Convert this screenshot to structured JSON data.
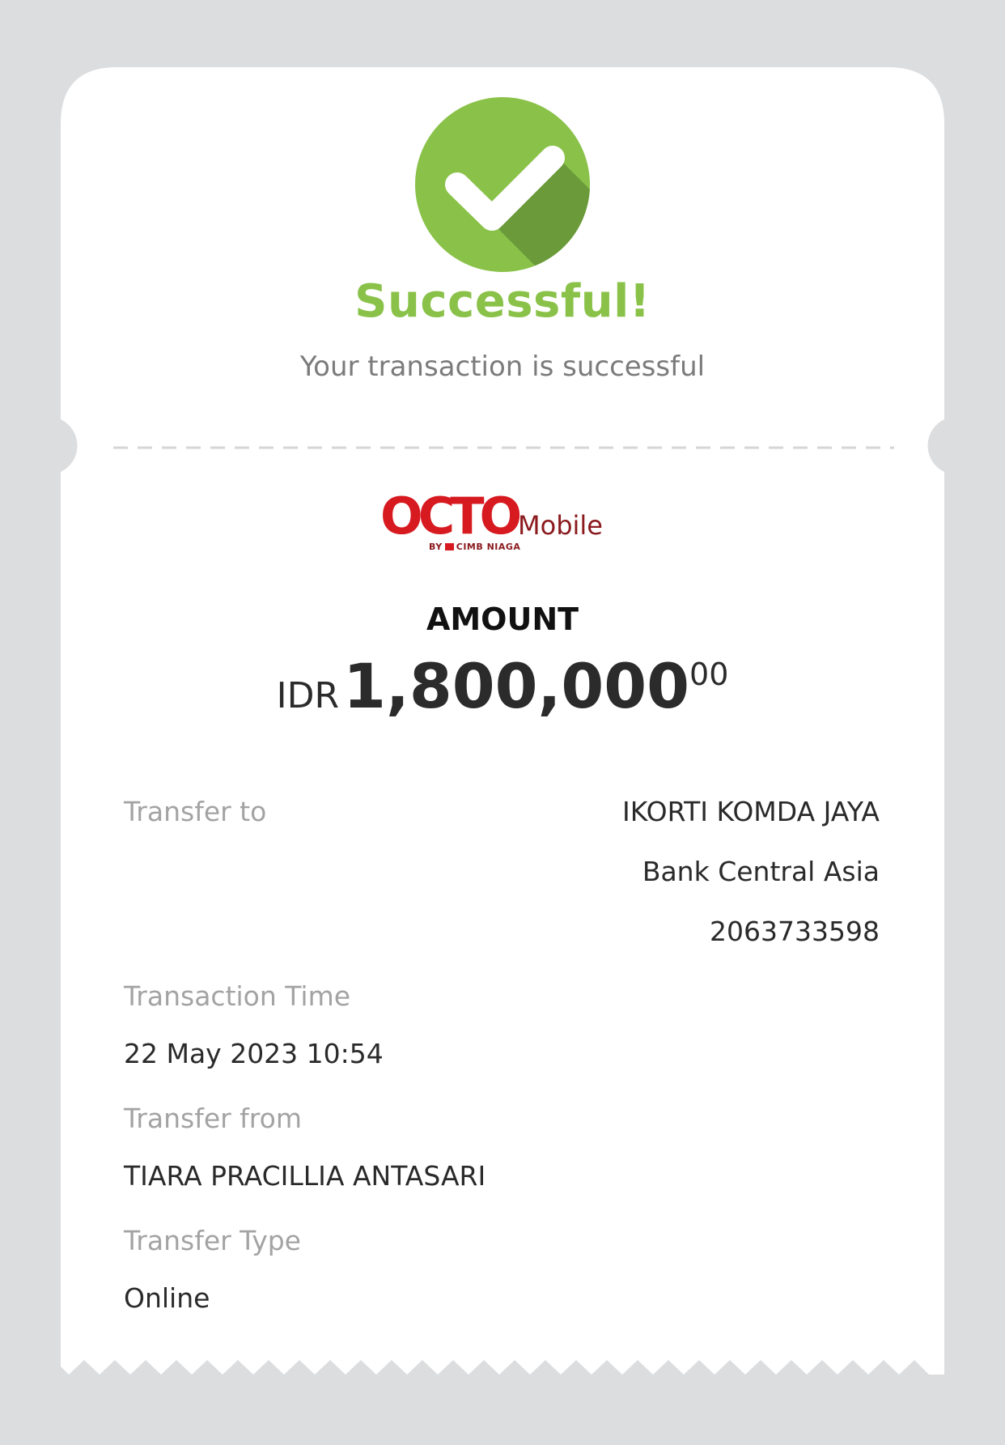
{
  "status": {
    "title": "Successful!",
    "subtitle": "Your transaction is successful"
  },
  "logo": {
    "brand": "OCTO",
    "product": "Mobile",
    "byline_prefix": "BY",
    "byline_bank": "CIMB NIAGA"
  },
  "amount": {
    "label": "AMOUNT",
    "currency": "IDR",
    "value": "1,800,000",
    "decimals": "00"
  },
  "details": {
    "transfer_to_label": "Transfer to",
    "transfer_to_name": "IKORTI KOMDA JAYA",
    "transfer_to_bank": "Bank Central Asia",
    "transfer_to_account": "2063733598",
    "transaction_time_label": "Transaction Time",
    "transaction_time_value": "22 May 2023 10:54",
    "transfer_from_label": "Transfer from",
    "transfer_from_value": "TIARA PRACILLIA ANTASARI",
    "transfer_type_label": "Transfer Type",
    "transfer_type_value": "Online"
  },
  "colors": {
    "background": "#dcdddf",
    "card": "#ffffff",
    "success_green": "#8ac249",
    "success_green_dark": "#6a9a3a",
    "brand_red": "#d71920"
  }
}
